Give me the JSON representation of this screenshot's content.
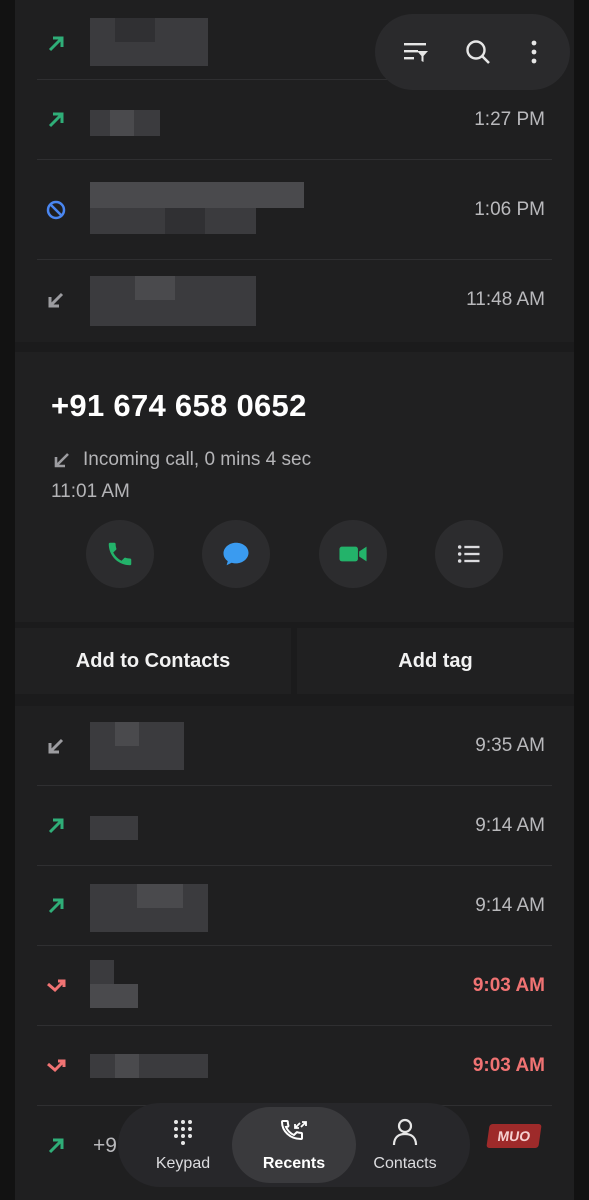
{
  "top_actions": {
    "filter_icon": "filter-icon",
    "search_icon": "search-icon",
    "more_icon": "more-vertical-icon"
  },
  "recents_top": [
    {
      "type": "outgoing",
      "time": "",
      "missed": false
    },
    {
      "type": "outgoing",
      "time": "1:27 PM",
      "missed": false
    },
    {
      "type": "blocked",
      "time": "1:06 PM",
      "missed": false
    },
    {
      "type": "incoming",
      "time": "11:48 AM",
      "missed": false
    }
  ],
  "expanded": {
    "number": "+91 674 658 0652",
    "call_info": "Incoming call, 0 mins 4 sec",
    "call_time": "11:01 AM",
    "actions": [
      "call-icon",
      "message-icon",
      "video-call-icon",
      "details-icon"
    ]
  },
  "buttons": {
    "add_to_contacts": "Add to Contacts",
    "add_tag": "Add tag"
  },
  "recents_bottom": [
    {
      "type": "incoming",
      "time": "9:35 AM",
      "missed": false
    },
    {
      "type": "outgoing",
      "time": "9:14 AM",
      "missed": false
    },
    {
      "type": "outgoing",
      "time": "9:14 AM",
      "missed": false
    },
    {
      "type": "missed",
      "time": "9:03 AM",
      "missed": true
    },
    {
      "type": "missed",
      "time": "9:03 AM",
      "missed": true
    },
    {
      "type": "outgoing",
      "name_partial": "+9",
      "time": "",
      "missed": false
    }
  ],
  "nav": {
    "keypad": "Keypad",
    "recents": "Recents",
    "contacts": "Contacts"
  },
  "watermark": "MUO",
  "colors": {
    "outgoing": "#2fae78",
    "blocked": "#4a86f0",
    "incoming": "#9c9ca0",
    "missed": "#f07373",
    "call_green": "#23b36a",
    "message_blue": "#3a9bf0"
  }
}
